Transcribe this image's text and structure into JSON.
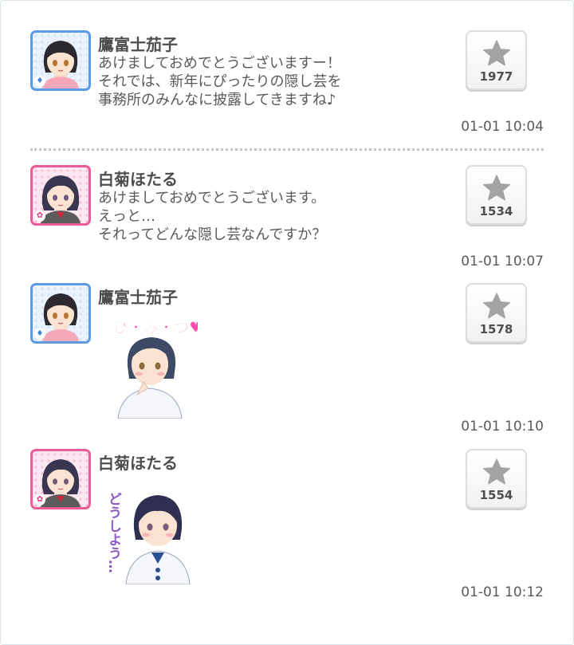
{
  "posts": [
    {
      "author": "鷹富士茄子",
      "lines": [
        "あけましておめでとうございますー！",
        "それでは、新年にぴったりの隠し芸を",
        "事務所のみんなに披露してきますね♪"
      ],
      "stars": "1977",
      "time": "01-01 10:04",
      "avatar_theme": "blue"
    },
    {
      "author": "白菊ほたる",
      "lines": [
        "あけましておめでとうございます。",
        "えっと…",
        "それってどんな隠し芸なんですか？"
      ],
      "stars": "1534",
      "time": "01-01 10:07",
      "avatar_theme": "pink"
    },
    {
      "author": "鷹富士茄子",
      "sticker_text": "ひ・み・つ♥",
      "stars": "1578",
      "time": "01-01 10:10",
      "avatar_theme": "blue"
    },
    {
      "author": "白菊ほたる",
      "sticker_text": "どうしよう…",
      "stars": "1554",
      "time": "01-01 10:12",
      "avatar_theme": "pink"
    }
  ],
  "icons": {
    "star": "star-icon",
    "badge_blue": "diamond-icon",
    "badge_pink": "flower-icon"
  },
  "colors": {
    "blue_frame": "#5b9be3",
    "pink_frame": "#ea5b98",
    "star": "#a3a3a3"
  }
}
